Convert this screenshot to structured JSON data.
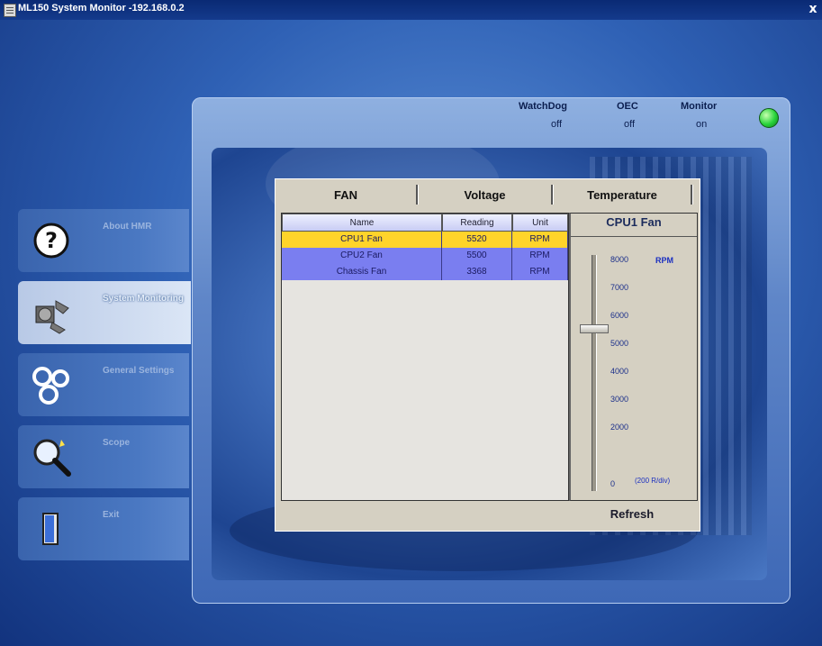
{
  "window": {
    "title": "ML150 System Monitor -192.168.0.2",
    "close_glyph": "x"
  },
  "status": {
    "watchdog_label": "WatchDog",
    "watchdog_value": "off",
    "oec_label": "OEC",
    "oec_value": "off",
    "monitor_label": "Monitor",
    "monitor_value": "on",
    "led_color": "#27d33a"
  },
  "nav": [
    {
      "label": "About HMR",
      "icon": "help-icon",
      "selected": false
    },
    {
      "label": "System Monitoring",
      "icon": "fan-icon",
      "selected": true
    },
    {
      "label": "General Settings",
      "icon": "gears-icon",
      "selected": false
    },
    {
      "label": "Scope",
      "icon": "magnifier-icon",
      "selected": false
    },
    {
      "label": "Exit",
      "icon": "door-icon",
      "selected": false
    }
  ],
  "tabs": [
    "FAN",
    "Voltage",
    "Temperature"
  ],
  "table": {
    "headers": [
      "Name",
      "Reading",
      "Unit"
    ],
    "rows": [
      {
        "name": "CPU1 Fan",
        "reading": "5520",
        "unit": "RPM"
      },
      {
        "name": "CPU2 Fan",
        "reading": "5500",
        "unit": "RPM"
      },
      {
        "name": "Chassis Fan",
        "reading": "3368",
        "unit": "RPM"
      }
    ]
  },
  "gauge": {
    "title": "CPU1 Fan",
    "unit": "RPM",
    "ticks": [
      "8000",
      "7000",
      "6000",
      "5000",
      "4000",
      "3000",
      "2000",
      "0"
    ],
    "scale_note": "(200 R/div)",
    "current_value": 5520,
    "max_value": 8000
  },
  "refresh_label": "Refresh"
}
